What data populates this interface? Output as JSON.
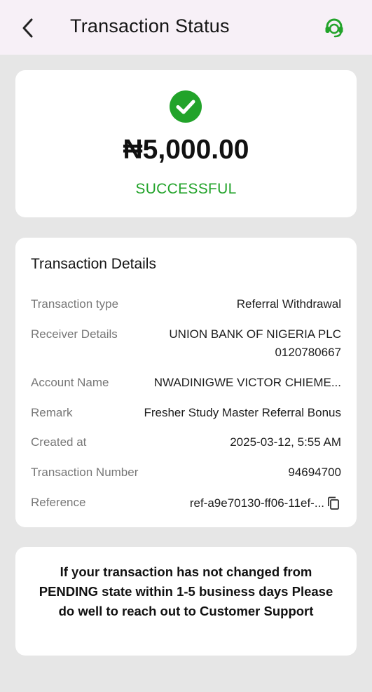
{
  "header": {
    "title": "Transaction Status"
  },
  "status": {
    "amount": "₦5,000.00",
    "state": "SUCCESSFUL"
  },
  "details": {
    "title": "Transaction Details",
    "rows": [
      {
        "label": "Transaction type",
        "value": "Referral Withdrawal"
      },
      {
        "label": "Receiver Details",
        "value": "UNION BANK OF NIGERIA PLC",
        "value2": "0120780667"
      },
      {
        "label": "Account Name",
        "value": "NWADINIGWE VICTOR CHIEME..."
      },
      {
        "label": "Remark",
        "value": "Fresher Study Master Referral Bonus"
      },
      {
        "label": "Created at",
        "value": "2025-03-12, 5:55 AM"
      },
      {
        "label": "Transaction Number",
        "value": "94694700"
      },
      {
        "label": "Reference",
        "value": "ref-a9e70130-ff06-11ef-..."
      }
    ]
  },
  "note": "If your transaction has not changed from PENDING state within 1-5 business days Please do well to reach out to Customer Support",
  "colors": {
    "success": "#22a32a",
    "header_bg": "#f7f0f7",
    "page_bg": "#e6e6e6"
  }
}
